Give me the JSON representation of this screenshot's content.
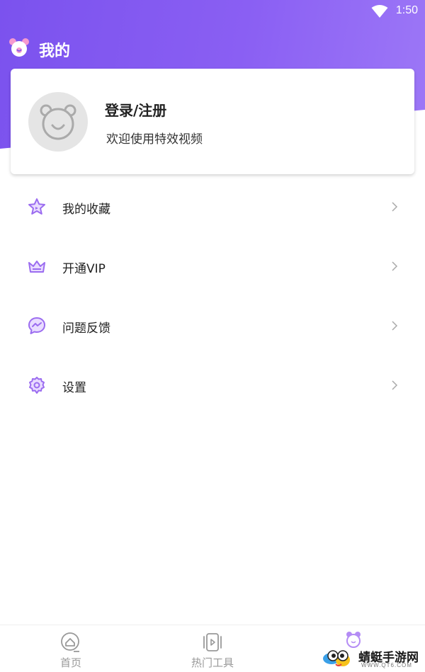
{
  "status_bar": {
    "time": "1:50",
    "wifi_icon": "wifi-icon"
  },
  "header": {
    "title": "我的",
    "logo_icon": "bear-logo-icon",
    "gradient_start": "#7b52ee",
    "gradient_end": "#9d78f7"
  },
  "profile": {
    "login_label": "登录/注册",
    "welcome": "欢迎使用特效视频",
    "avatar_icon": "bear-avatar-icon"
  },
  "menu": [
    {
      "label": "我的收藏",
      "icon": "star-icon"
    },
    {
      "label": "开通VIP",
      "icon": "crown-icon"
    },
    {
      "label": "问题反馈",
      "icon": "chat-bubble-icon"
    },
    {
      "label": "设置",
      "icon": "gear-icon"
    }
  ],
  "bottom_nav": [
    {
      "label": "首页",
      "icon": "home-icon"
    },
    {
      "label": "热门工具",
      "icon": "tools-icon"
    }
  ],
  "watermark": {
    "text": "蜻蜓手游网",
    "sub": "WWW.QT6.COM"
  },
  "colors": {
    "accent": "#8a5ff3",
    "icon_purple": "#9b6cf0"
  }
}
